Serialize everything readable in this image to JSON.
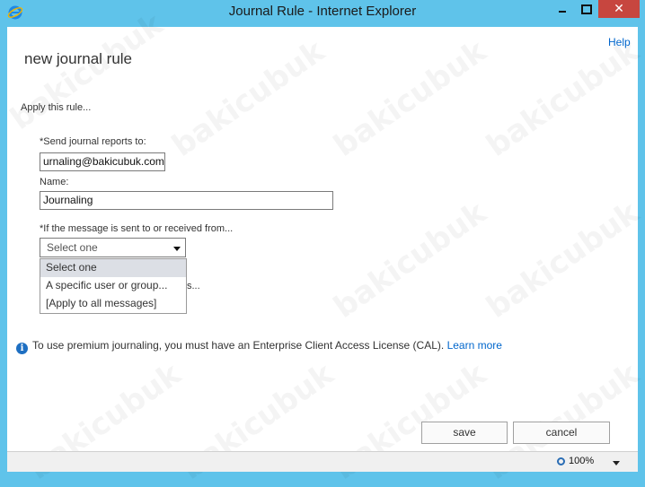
{
  "window": {
    "title": "Journal Rule - Internet Explorer",
    "minimize_icon": "minimize-icon",
    "maximize_icon": "maximize-icon",
    "close_label": "✕"
  },
  "page": {
    "help_link": "Help",
    "heading": "new journal rule",
    "apply_text": "Apply this rule...",
    "send_to_label": "*Send journal reports to:",
    "send_to_value": "urnaling@bakicubuk.com",
    "name_label": "Name:",
    "name_value": "Journaling",
    "condition_label": "*If the message is sent to or received from...",
    "condition_selected": "Select one",
    "condition_options": [
      "Select one",
      "A specific user or group...",
      "[Apply to all messages]"
    ],
    "partially_hidden_text": "s...",
    "info_text": "To use premium journaling, you must have an Enterprise Client Access License (CAL).",
    "learn_more": "Learn more",
    "save_label": "save",
    "cancel_label": "cancel"
  },
  "statusbar": {
    "zoom": "100%"
  },
  "watermark": "bakicubuk",
  "colors": {
    "titlebar": "#5fc3ea",
    "close_button": "#c7463f",
    "link": "#0066cc",
    "selected_option": "#dcdfe5"
  }
}
